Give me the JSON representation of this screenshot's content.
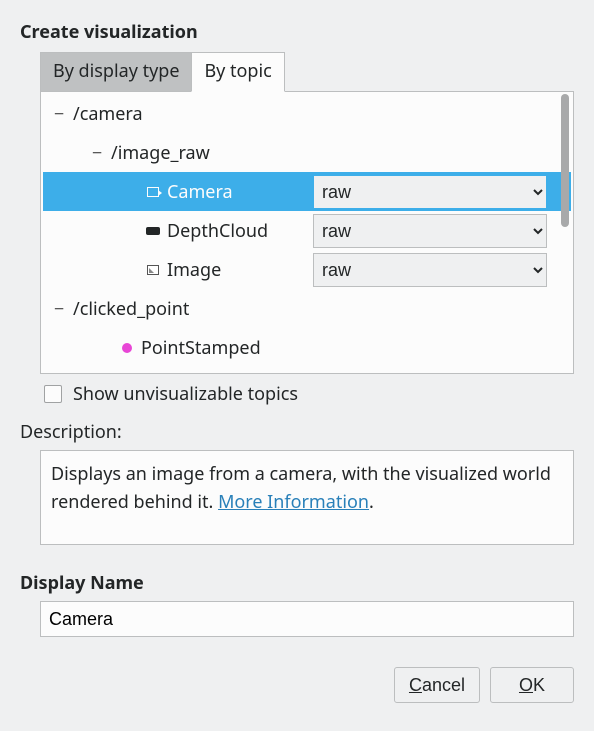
{
  "title": "Create visualization",
  "tabs": {
    "inactive": "By display type",
    "active": "By topic"
  },
  "tree": {
    "camera": "/camera",
    "image_raw": "/image_raw",
    "camera_item": "Camera",
    "depthcloud_item": "DepthCloud",
    "image_item": "Image",
    "clicked_point": "/clicked_point",
    "pointstamped_item": "PointStamped",
    "raw_option": "raw"
  },
  "show_unviz": "Show unvisualizable topics",
  "desc_label": "Description:",
  "desc_text": "Displays an image from a camera, with the visualized world rendered behind it. ",
  "more_info": "More Information",
  "period": ".",
  "display_name_label": "Display Name",
  "display_name_value": "Camera",
  "cancel": "ancel",
  "cancel_m": "C",
  "ok": "K",
  "ok_m": "O"
}
